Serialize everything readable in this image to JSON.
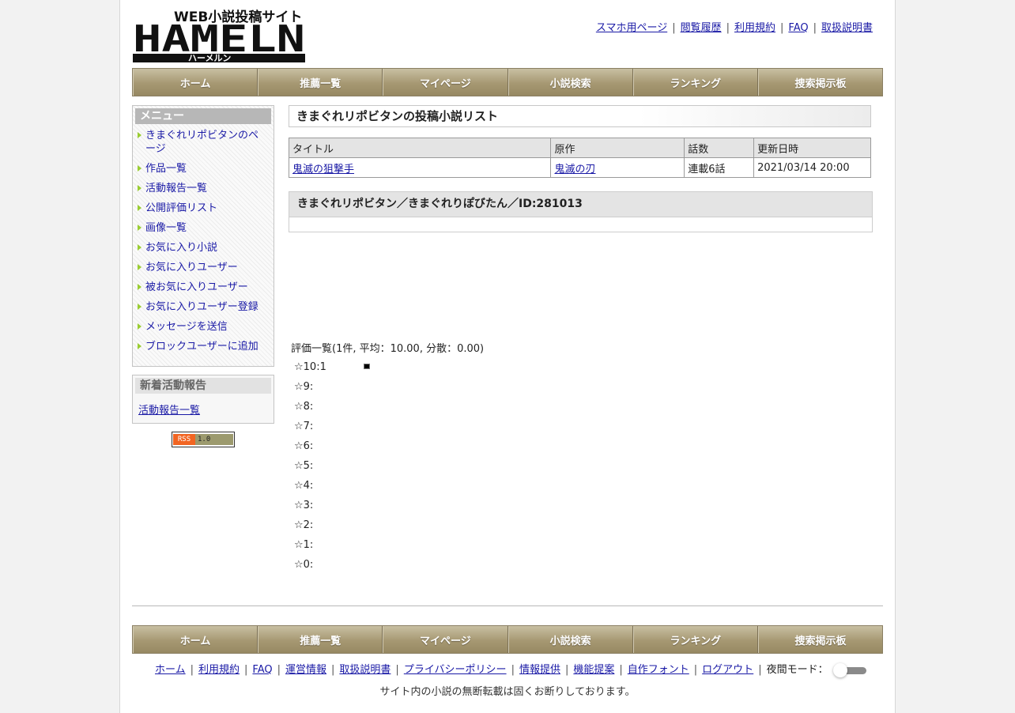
{
  "logo": {
    "top_text": "WEB小説投稿サイト",
    "main_text": "HAMELN",
    "sub_text": "ハーメルン"
  },
  "top_links": [
    "スマホ用ページ",
    "閲覧履歴",
    "利用規約",
    "FAQ",
    "取扱説明書"
  ],
  "nav": [
    "ホーム",
    "推薦一覧",
    "マイページ",
    "小説検索",
    "ランキング",
    "捜索掲示板"
  ],
  "sidebar": {
    "menu_title": "メニュー",
    "menu_items": [
      "きまぐれリポビタンのページ",
      "作品一覧",
      "活動報告一覧",
      "公開評価リスト",
      "画像一覧",
      "お気に入り小説",
      "お気に入りユーザー",
      "被お気に入りユーザー",
      "お気に入りユーザー登録",
      "メッセージを送信",
      "ブロックユーザーに追加"
    ],
    "news_title": "新着活動報告",
    "news_link": "活動報告一覧",
    "rss_left": "RSS",
    "rss_right": "1.0"
  },
  "main": {
    "list_title": "きまぐれリポビタンの投稿小説リスト",
    "table": {
      "headers": [
        "タイトル",
        "原作",
        "話数",
        "更新日時"
      ],
      "rows": [
        [
          "鬼滅の狙撃手",
          "鬼滅の刃",
          "連載6話",
          "2021/03/14 20:00"
        ]
      ]
    },
    "user_header": "きまぐれリポビタン／きまぐれりぽびたん／ID:281013",
    "ratings": {
      "summary": "評価一覧(1件, 平均：10.00, 分散：0.00)",
      "rows": [
        {
          "label": "☆10:1",
          "fraction": 1.0
        },
        {
          "label": "☆9:",
          "fraction": 0
        },
        {
          "label": "☆8:",
          "fraction": 0
        },
        {
          "label": "☆7:",
          "fraction": 0
        },
        {
          "label": "☆6:",
          "fraction": 0
        },
        {
          "label": "☆5:",
          "fraction": 0
        },
        {
          "label": "☆4:",
          "fraction": 0
        },
        {
          "label": "☆3:",
          "fraction": 0
        },
        {
          "label": "☆2:",
          "fraction": 0
        },
        {
          "label": "☆1:",
          "fraction": 0
        },
        {
          "label": "☆0:",
          "fraction": 0
        }
      ]
    }
  },
  "footer": {
    "links": [
      "ホーム",
      "利用規約",
      "FAQ",
      "運営情報",
      "取扱説明書",
      "プライバシーポリシー",
      "情報提供",
      "機能提案",
      "自作フォント",
      "ログアウト"
    ],
    "night_mode_label": "夜間モード：",
    "night_mode_on": false,
    "copyright": "サイト内の小説の無断転載は固くお断りしております。"
  }
}
